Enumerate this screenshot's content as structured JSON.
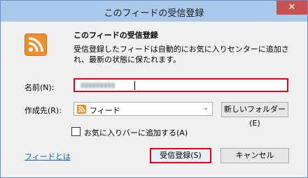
{
  "window": {
    "title": "このフィードの受信登録",
    "close_label": "✕"
  },
  "header": {
    "heading": "このフィードの受信登録",
    "description": "受信登録したフィードは自動的にお気に入りセンターに追加され、最新の状態に保たれます。"
  },
  "form": {
    "name_label": "名前(N):",
    "name_value": "▮▮▮▮▮▮▮▮▮",
    "folder_label": "作成先(R):",
    "folder_value": "フィード",
    "new_folder_label": "新しいフォルダー(E)",
    "favorites_bar_label": "お気に入りバーに追加する(A)",
    "favorites_bar_checked": false
  },
  "footer": {
    "about_feeds_link": "フィードとは",
    "subscribe_label": "受信登録(S)",
    "cancel_label": "キャンセル"
  },
  "colors": {
    "titlebar": "#a9c8ea",
    "highlight": "#e0001b",
    "rss": "#f08d2c",
    "link": "#0066cc"
  }
}
